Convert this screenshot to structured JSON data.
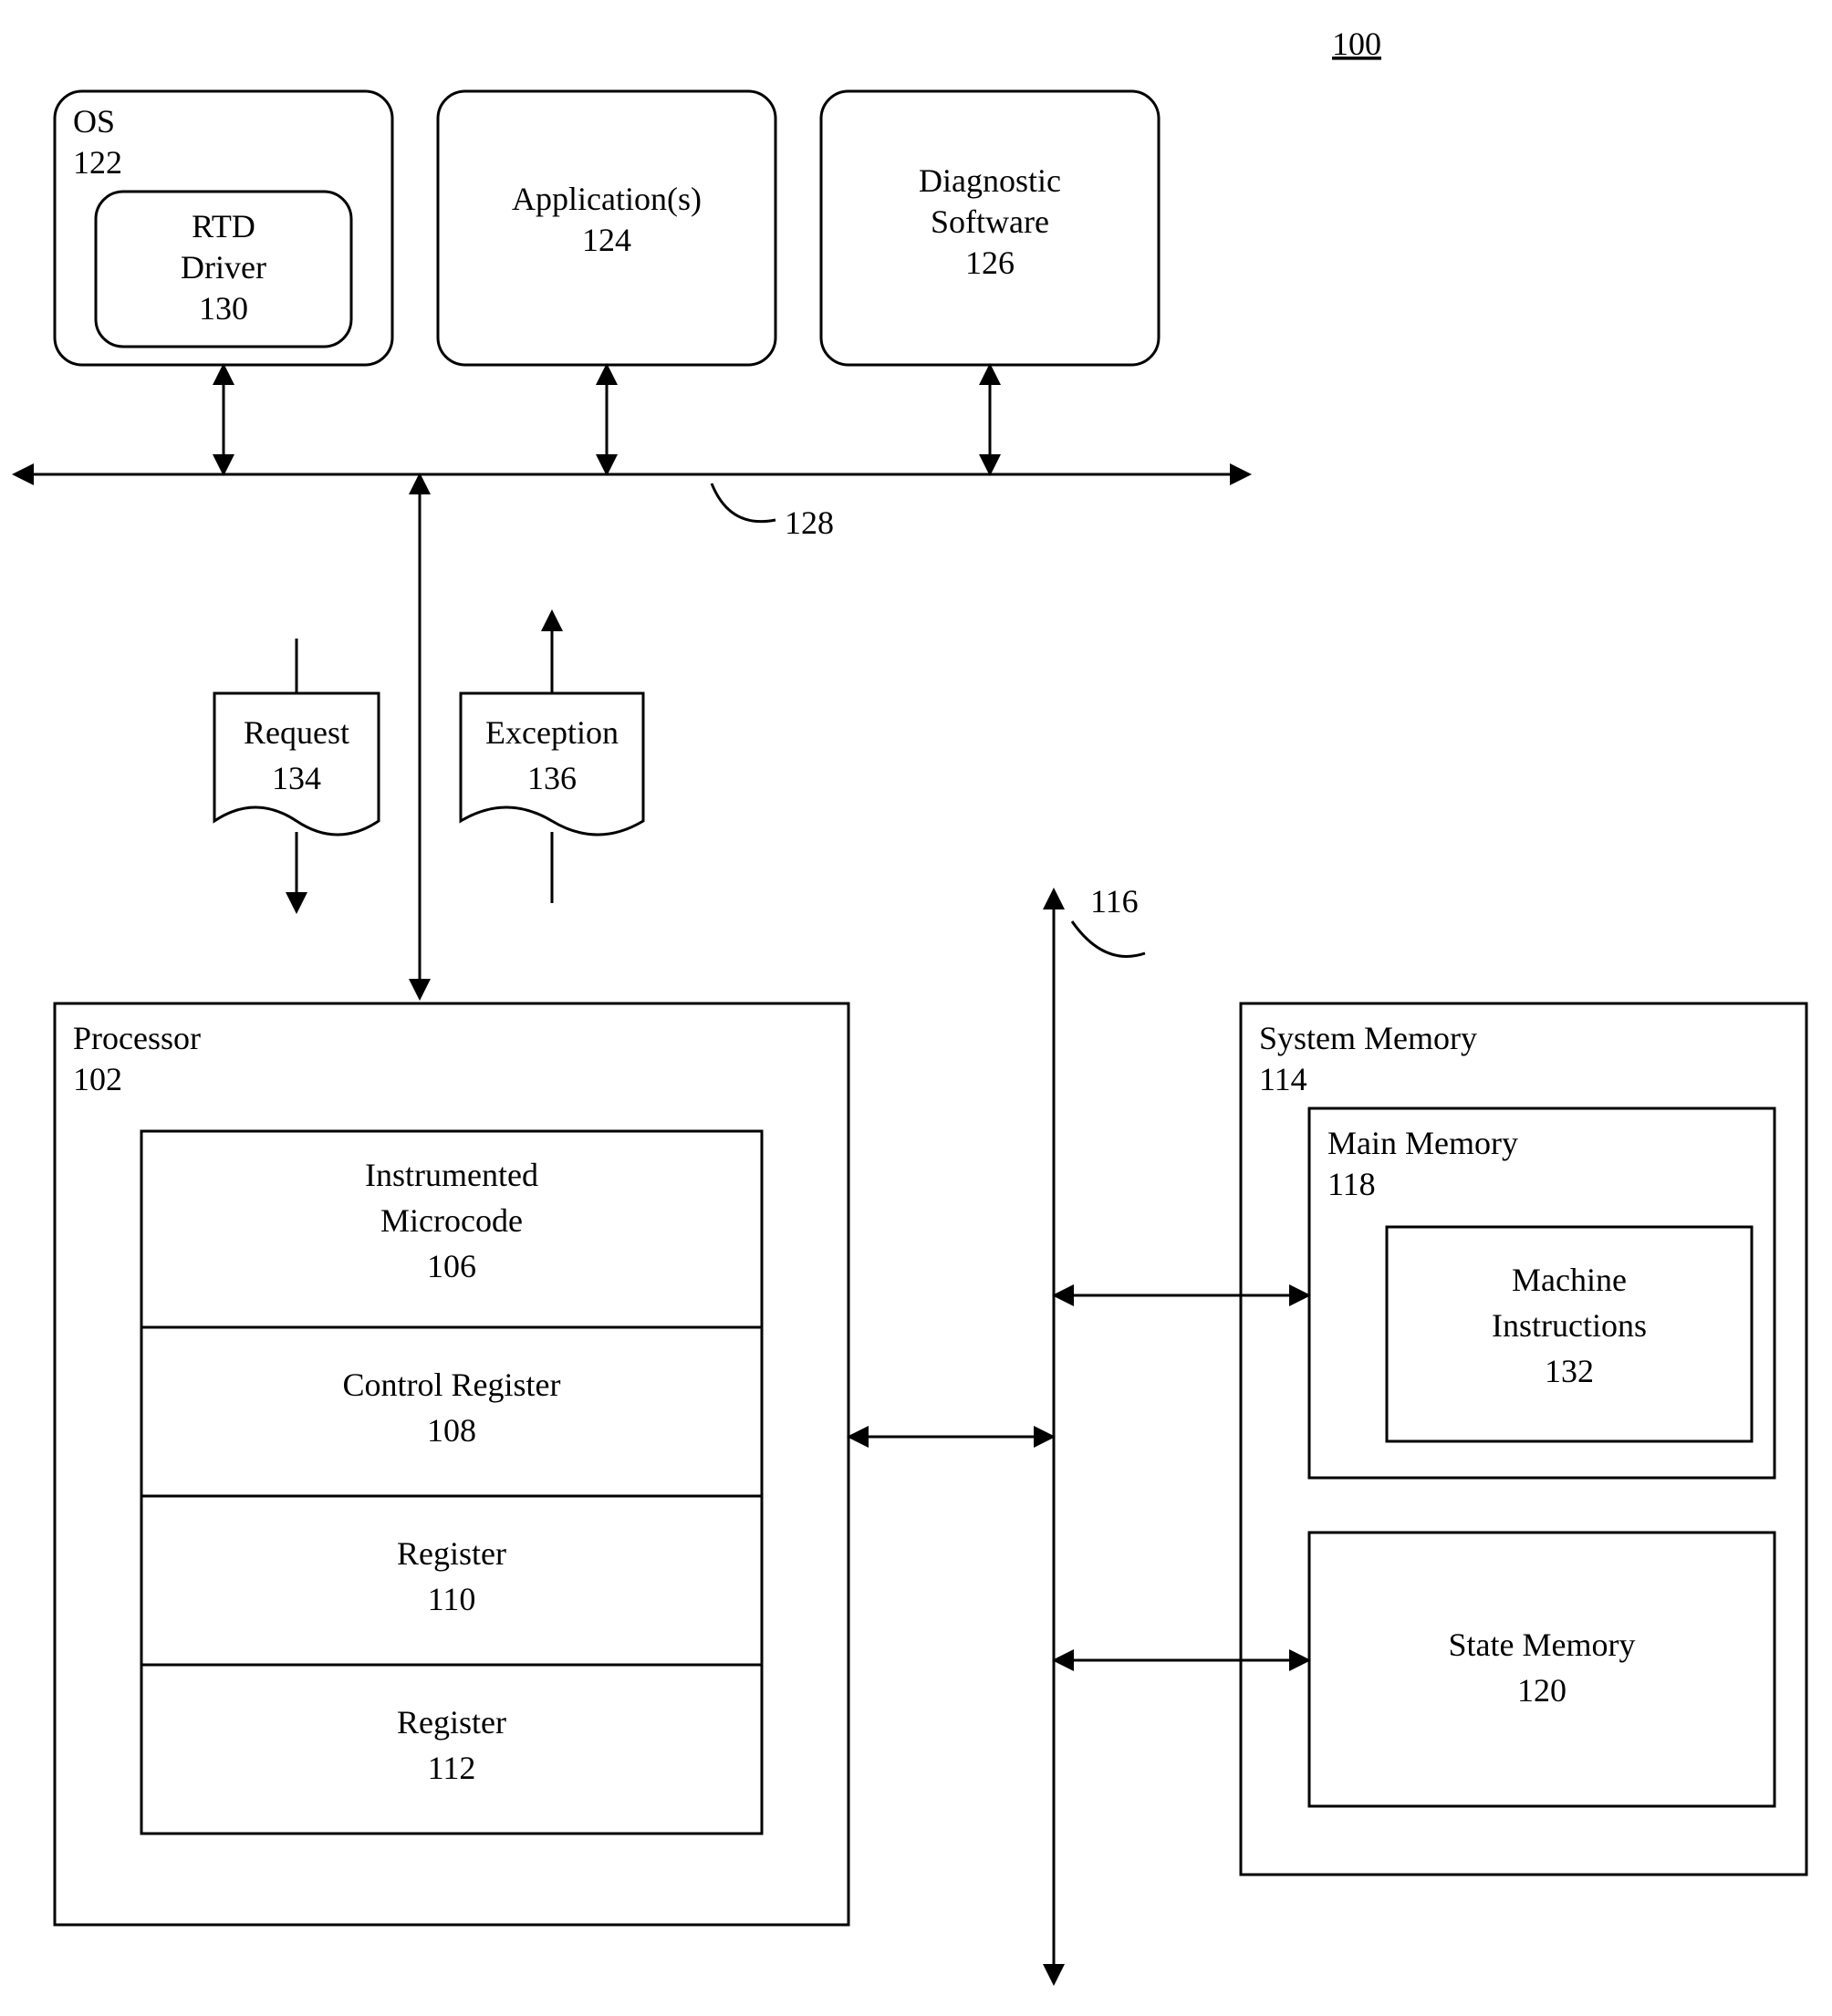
{
  "figure_number": "100",
  "os": {
    "title": "OS",
    "ref": "122"
  },
  "rtd_driver": {
    "line1": "RTD",
    "line2": "Driver",
    "ref": "130"
  },
  "applications": {
    "title": "Application(s)",
    "ref": "124"
  },
  "diagnostic_software": {
    "line1": "Diagnostic",
    "line2": "Software",
    "ref": "126"
  },
  "bus_ref": "128",
  "request": {
    "title": "Request",
    "ref": "134"
  },
  "exception": {
    "title": "Exception",
    "ref": "136"
  },
  "processor": {
    "title": "Processor",
    "ref": "102"
  },
  "instrumented_microcode": {
    "line1": "Instrumented",
    "line2": "Microcode",
    "ref": "106"
  },
  "control_register": {
    "title": "Control Register",
    "ref": "108"
  },
  "register_a": {
    "title": "Register",
    "ref": "110"
  },
  "register_b": {
    "title": "Register",
    "ref": "112"
  },
  "memory_bus_ref": "116",
  "system_memory": {
    "title": "System Memory",
    "ref": "114"
  },
  "main_memory": {
    "title": "Main Memory",
    "ref": "118"
  },
  "machine_instructions": {
    "line1": "Machine",
    "line2": "Instructions",
    "ref": "132"
  },
  "state_memory": {
    "title": "State Memory",
    "ref": "120"
  }
}
